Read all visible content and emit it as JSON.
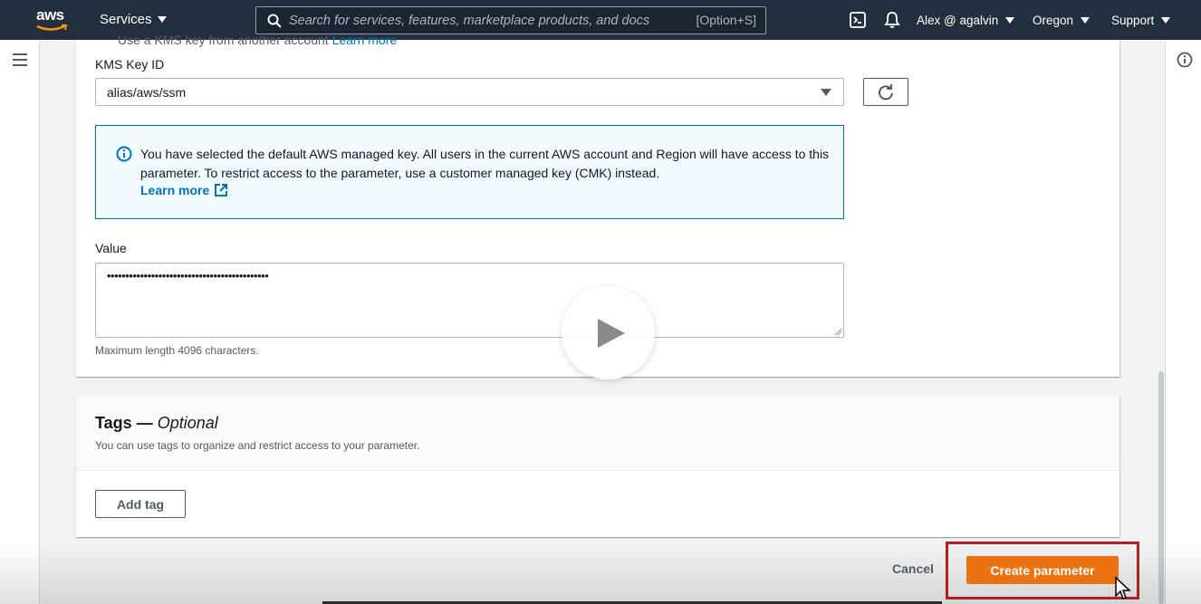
{
  "header": {
    "logo_text": "aws",
    "services_label": "Services",
    "search_placeholder": "Search for services, features, marketplace products, and docs",
    "search_shortcut": "[Option+S]",
    "account_label": "Alex @ agalvin",
    "region_label": "Oregon",
    "support_label": "Support",
    "icons": [
      "cloudshell-icon",
      "notifications-bell-icon"
    ]
  },
  "form": {
    "clipped_option_text": "Use a KMS key from another account",
    "clipped_option_link": "Learn more",
    "kms_label": "KMS Key ID",
    "kms_value": "alias/aws/ssm",
    "alert_text": "You have selected the default AWS managed key. All users in the current AWS account and Region will have access to this parameter. To restrict access to the parameter, use a customer managed key (CMK) instead.",
    "alert_link": "Learn more",
    "value_label": "Value",
    "value_masked": "••••••••••••••••••••••••••••••••••••••••••••",
    "value_hint": "Maximum length 4096 characters."
  },
  "tags": {
    "title": "Tags",
    "title_separator": " — ",
    "title_optional": "Optional",
    "description": "You can use tags to organize and restrict access to your parameter.",
    "add_button": "Add tag"
  },
  "actions": {
    "cancel_label": "Cancel",
    "create_label": "Create parameter"
  },
  "colors": {
    "nav_bg": "#232f3e",
    "primary_button": "#ec7211",
    "link": "#0073bb",
    "highlight_box": "#b21f24"
  }
}
